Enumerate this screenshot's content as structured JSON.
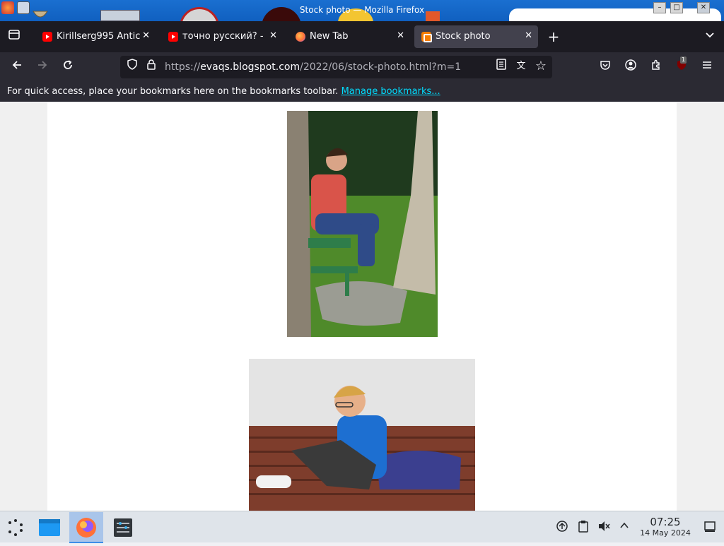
{
  "window": {
    "title": "Stock photo — Mozilla Firefox"
  },
  "tabs": [
    {
      "label": "Kirillserg995 Antic",
      "icon": "youtube-icon",
      "active": false
    },
    {
      "label": "точно русский? - ",
      "icon": "youtube-icon",
      "active": false
    },
    {
      "label": "New Tab",
      "icon": "firefox-icon",
      "active": false
    },
    {
      "label": "Stock photo",
      "icon": "blogger-icon",
      "active": true
    }
  ],
  "urlbar": {
    "scheme": "https://",
    "domain": "evaqs.blogspot.com",
    "path": "/2022/06/stock-photo.html?m=1"
  },
  "bookmarks_bar": {
    "message": "For quick access, place your bookmarks here on the bookmarks toolbar. ",
    "link": "Manage bookmarks..."
  },
  "extensions": {
    "badge": "1"
  },
  "page": {
    "images": [
      {
        "name": "teen-on-bench-photo"
      },
      {
        "name": "boy-on-bench-photo"
      }
    ]
  },
  "taskbar": {
    "time": "07:25",
    "date": "14 May 2024"
  }
}
